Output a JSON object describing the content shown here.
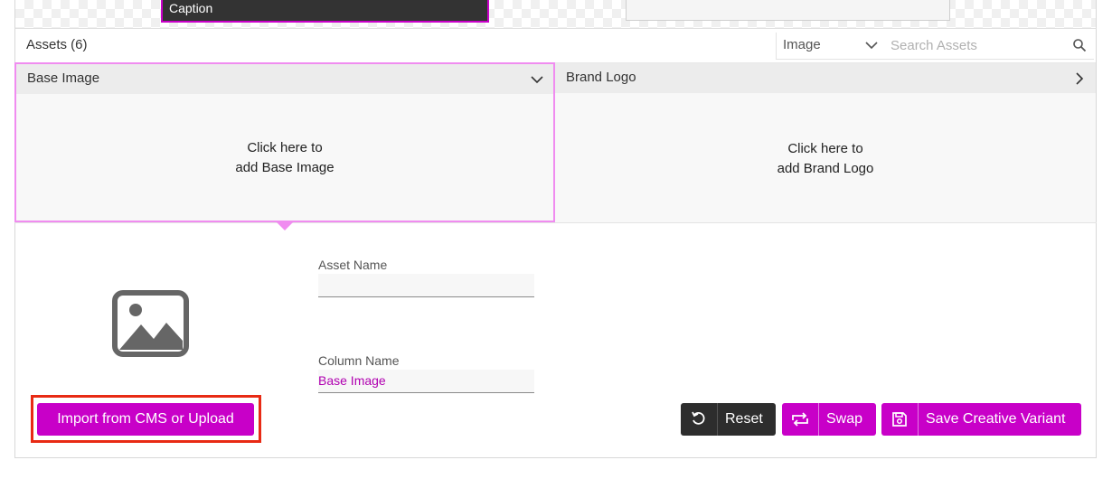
{
  "preview": {
    "caption_label": "Caption"
  },
  "assets": {
    "title": "Assets (6)",
    "filter": {
      "selected": "Image"
    },
    "search": {
      "placeholder": "Search Assets",
      "value": ""
    },
    "cards": [
      {
        "title": "Base Image",
        "prompt_line1": "Click here to",
        "prompt_line2": "add Base Image",
        "expanded": true
      },
      {
        "title": "Brand Logo",
        "prompt_line1": "Click here to",
        "prompt_line2": "add Brand Logo",
        "expanded": false
      }
    ]
  },
  "detail": {
    "asset_name": {
      "label": "Asset Name",
      "value": ""
    },
    "column_name": {
      "label": "Column Name",
      "value": "Base Image"
    }
  },
  "actions": {
    "import_label": "Import from CMS or Upload",
    "reset_label": "Reset",
    "swap_label": "Swap",
    "save_label": "Save Creative Variant"
  },
  "colors": {
    "accent": "#c800c8",
    "highlight": "#f08cf0",
    "dark": "#2d2d2d",
    "focus_outline": "#e82a14"
  }
}
